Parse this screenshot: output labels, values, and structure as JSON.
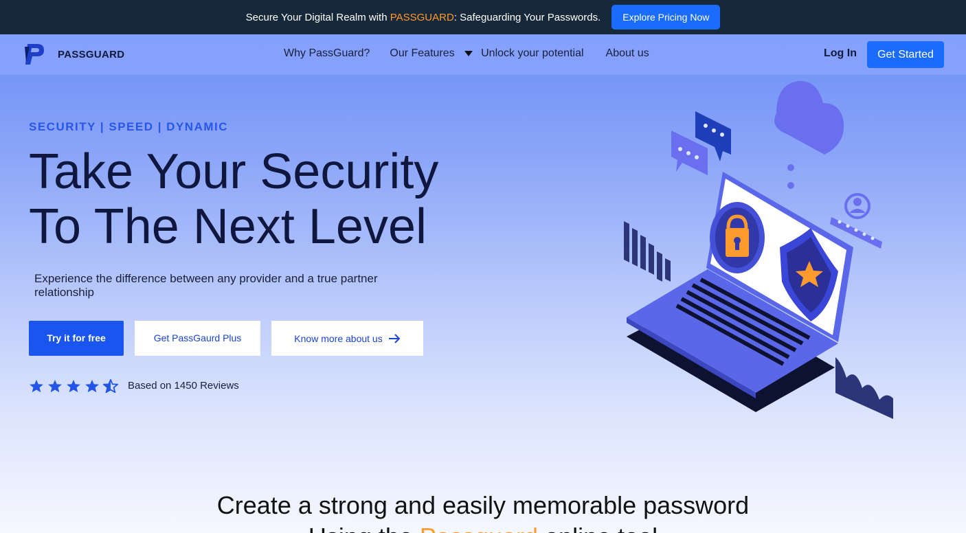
{
  "announcement": {
    "text_before": "Secure Your Digital Realm with ",
    "brand": "PASSGUARD",
    "text_after": ": Safeguarding Your Passwords.",
    "button": "Explore Pricing Now"
  },
  "nav": {
    "logo_text": "PASSGUARD",
    "links": [
      "Why PassGuard?",
      "Our Features",
      "Unlock your potential",
      "About us"
    ],
    "login": "Log In",
    "cta": "Get Started"
  },
  "hero": {
    "tagline": "SECURITY | SPEED | DYNAMIC",
    "headline_line1": "Take Your Security",
    "headline_line2": "To The Next Level",
    "subtitle": "Experience the difference between any provider and a true partner relationship",
    "buttons": {
      "primary": "Try it for free",
      "plus": "Get PassGaurd Plus",
      "more": "Know more about us"
    },
    "rating": 4.5,
    "reviews": "Based on 1450 Reviews"
  },
  "section": {
    "heading_line1": "Create a strong and easily memorable password",
    "heading_line2_before": "Using the ",
    "heading_line2_accent": "Passguard",
    "heading_line2_after": " online tool"
  },
  "colors": {
    "brand_blue": "#1a6cff",
    "accent_orange": "#ff9a2e",
    "dark_bar": "#16283a"
  }
}
